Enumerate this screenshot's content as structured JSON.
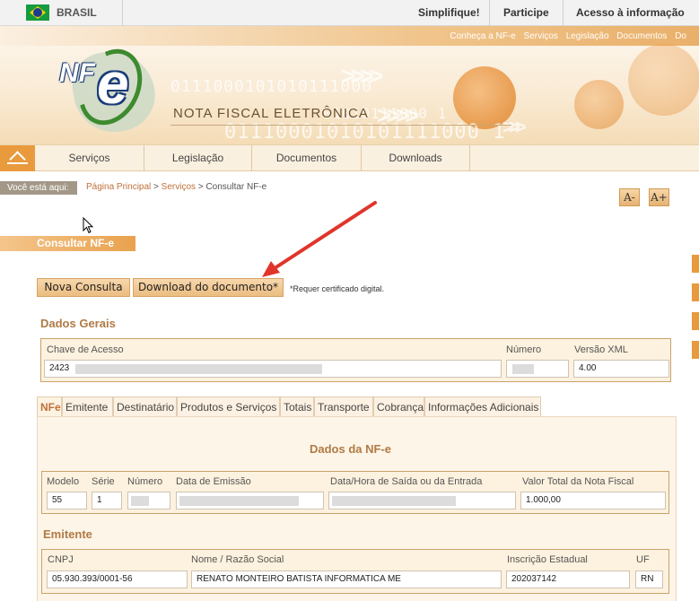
{
  "gov_bar": {
    "country": "BRASIL",
    "links": [
      "Simplifique!",
      "Participe",
      "Acesso à informação"
    ]
  },
  "banner": {
    "top_links": [
      "Conheça a NF-e",
      "Serviços",
      "Legislação",
      "Documentos",
      "Do"
    ],
    "logo_text": "NF-e",
    "title": "NOTA FISCAL ELETRÔNICA",
    "binary_1": "0111000101010111000",
    "binary_2": "01110001010101111000 1",
    "binary_3": "01010111000 1"
  },
  "nav": {
    "items": [
      "Serviços",
      "Legislação",
      "Documentos",
      "Downloads"
    ]
  },
  "breadcrumb": {
    "label": "Você está aqui:",
    "home": "Página Principal",
    "sep1": " > ",
    "services": "Serviços",
    "sep2": " > ",
    "current": "Consultar NF-e"
  },
  "font_controls": {
    "decrease": "A-",
    "increase": "A+"
  },
  "page_title": "Consultar NF-e",
  "actions": {
    "new_query": "Nova Consulta",
    "download": "Download do documento*",
    "cert_note": "*Requer certificado digital."
  },
  "dados_gerais": {
    "title": "Dados Gerais",
    "chave_label": "Chave de Acesso",
    "chave_value": "2423",
    "numero_label": "Número",
    "versao_label": "Versão XML",
    "versao_value": "4.00"
  },
  "tabs": [
    "NFe",
    "Emitente",
    "Destinatário",
    "Produtos e Serviços",
    "Totais",
    "Transporte",
    "Cobrança",
    "Informações Adicionais"
  ],
  "active_tab": "NFe",
  "dados_nfe": {
    "title": "Dados da NF-e",
    "modelo_label": "Modelo",
    "modelo_value": "55",
    "serie_label": "Série",
    "serie_value": "1",
    "numero_label": "Número",
    "emissao_label": "Data de Emissão",
    "saida_label": "Data/Hora de Saída ou da Entrada",
    "valor_label": "Valor Total da Nota Fiscal",
    "valor_value": "1.000,00"
  },
  "emitente": {
    "title": "Emitente",
    "cnpj_label": "CNPJ",
    "cnpj_value": "05.930.393/0001-56",
    "nome_label": "Nome / Razão Social",
    "nome_value": "RENATO MONTEIRO BATISTA INFORMATICA ME",
    "ie_label": "Inscrição Estadual",
    "ie_value": "202037142",
    "uf_label": "UF",
    "uf_value": "RN"
  },
  "colors": {
    "accent_orange": "#e99a3d",
    "section_title": "#b07a44",
    "annotation_arrow": "#e0352b"
  }
}
